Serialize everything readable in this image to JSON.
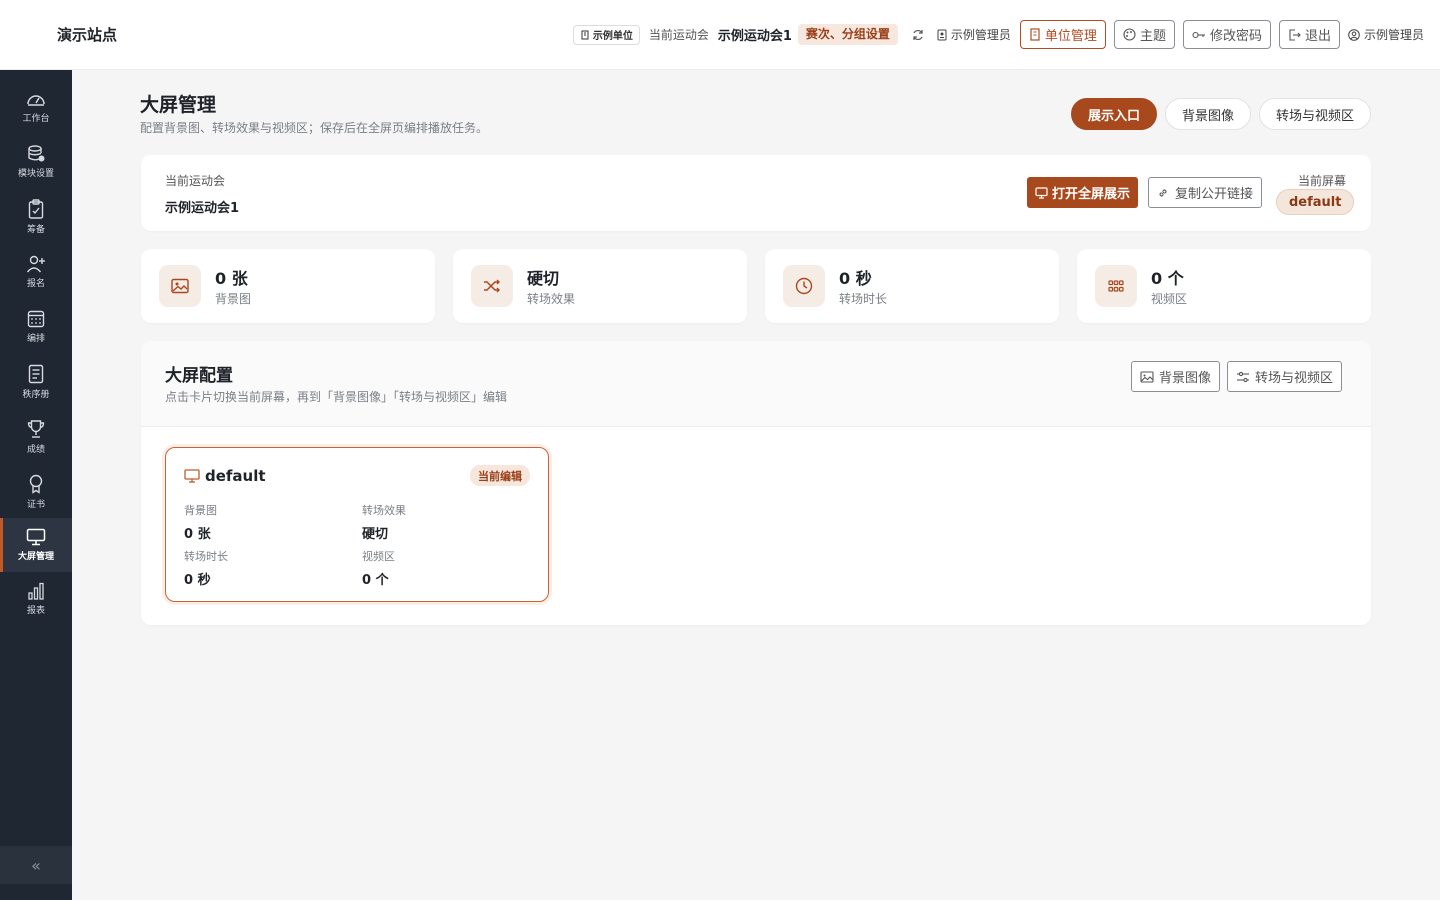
{
  "site": {
    "title": "演示站点"
  },
  "header": {
    "unit_chip": "示例单位",
    "current_meet_label": "当前运动会",
    "current_meet_name": "示例运动会1",
    "round_setting": "赛次、分组设置",
    "admin_label": "示例管理员",
    "unit_manage": "单位管理",
    "theme": "主题",
    "change_password": "修改密码",
    "logout": "退出",
    "user_name": "示例管理员"
  },
  "sidebar": {
    "items": [
      {
        "label": "工作台",
        "icon": "dashboard-icon"
      },
      {
        "label": "模块设置",
        "icon": "database-settings-icon"
      },
      {
        "label": "筹备",
        "icon": "clipboard-icon"
      },
      {
        "label": "报名",
        "icon": "user-add-icon"
      },
      {
        "label": "编排",
        "icon": "calendar-grid-icon"
      },
      {
        "label": "秩序册",
        "icon": "document-list-icon"
      },
      {
        "label": "成绩",
        "icon": "trophy-icon"
      },
      {
        "label": "证书",
        "icon": "award-icon"
      },
      {
        "label": "大屏管理",
        "icon": "monitor-icon",
        "active": true
      },
      {
        "label": "报表",
        "icon": "bar-chart-icon"
      }
    ],
    "collapse_icon": "«"
  },
  "page": {
    "title": "大屏管理",
    "subtitle": "配置背景图、转场效果与视频区；保存后在全屏页编排播放任务。",
    "tabs": [
      "展示入口",
      "背景图像",
      "转场与视频区"
    ]
  },
  "meet_card": {
    "label": "当前运动会",
    "name": "示例运动会1",
    "open_fullscreen": "打开全屏展示",
    "copy_link": "复制公开链接",
    "current_screen_label": "当前屏幕",
    "current_screen": "default"
  },
  "stats": [
    {
      "value": "0 张",
      "label": "背景图",
      "icon": "image-icon"
    },
    {
      "value": "硬切",
      "label": "转场效果",
      "icon": "shuffle-icon"
    },
    {
      "value": "0 秒",
      "label": "转场时长",
      "icon": "clock-icon"
    },
    {
      "value": "0 个",
      "label": "视频区",
      "icon": "grid-icon"
    }
  ],
  "config": {
    "title": "大屏配置",
    "subtitle": "点击卡片切换当前屏幕，再到「背景图像」「转场与视频区」编辑",
    "bg_button": "背景图像",
    "transition_button": "转场与视频区",
    "screen_card": {
      "name": "default",
      "badge": "当前编辑",
      "fields": [
        {
          "label": "背景图",
          "value": "0 张"
        },
        {
          "label": "转场效果",
          "value": "硬切"
        },
        {
          "label": "转场时长",
          "value": "0 秒"
        },
        {
          "label": "视频区",
          "value": "0 个"
        }
      ]
    }
  },
  "colors": {
    "accent": "#a8481d",
    "sidebar_bg": "#1f2733",
    "badge_bg": "#f7e8df"
  }
}
